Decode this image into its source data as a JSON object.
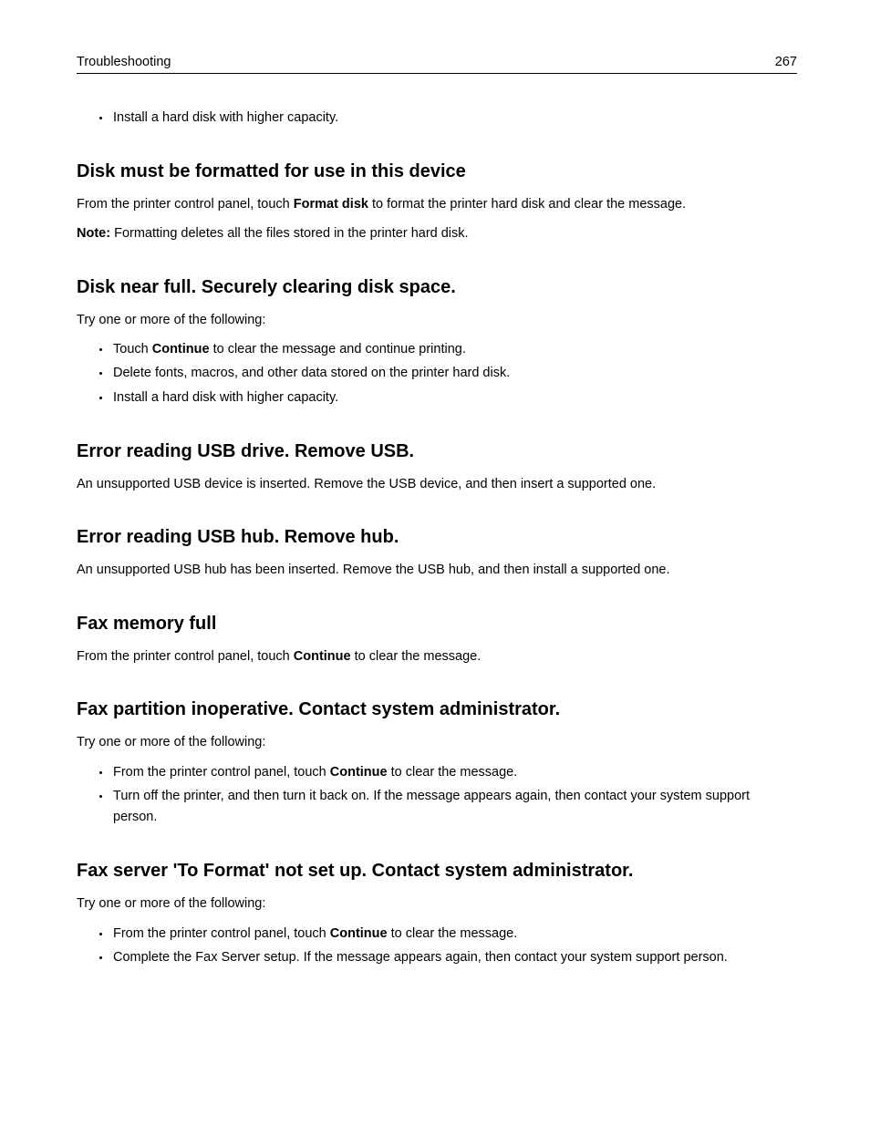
{
  "header": {
    "title": "Troubleshooting",
    "page_number": "267"
  },
  "orphan_bullet": "Install a hard disk with higher capacity.",
  "sections": {
    "disk_format": {
      "heading": "Disk must be formatted for use in this device",
      "p1_a": "From the printer control panel, touch ",
      "p1_bold": "Format disk",
      "p1_b": " to format the printer hard disk and clear the message.",
      "p2_bold": "Note:",
      "p2_b": " Formatting deletes all the files stored in the printer hard disk."
    },
    "disk_near_full": {
      "heading": "Disk near full. Securely clearing disk space.",
      "intro": "Try one or more of the following:",
      "b1_a": "Touch ",
      "b1_bold": "Continue",
      "b1_b": " to clear the message and continue printing.",
      "b2": "Delete fonts, macros, and other data stored on the printer hard disk.",
      "b3": "Install a hard disk with higher capacity."
    },
    "usb_drive": {
      "heading": "Error reading USB drive. Remove USB.",
      "p1": "An unsupported USB device is inserted. Remove the USB device, and then insert a supported one."
    },
    "usb_hub": {
      "heading": "Error reading USB hub. Remove hub.",
      "p1": "An unsupported USB hub has been inserted. Remove the USB hub, and then install a supported one."
    },
    "fax_memory": {
      "heading": "Fax memory full",
      "p1_a": "From the printer control panel, touch ",
      "p1_bold": "Continue",
      "p1_b": " to clear the message."
    },
    "fax_partition": {
      "heading": "Fax partition inoperative. Contact system administrator.",
      "intro": "Try one or more of the following:",
      "b1_a": "From the printer control panel, touch ",
      "b1_bold": "Continue",
      "b1_b": " to clear the message.",
      "b2": "Turn off the printer, and then turn it back on. If the message appears again, then contact your system support person."
    },
    "fax_server": {
      "heading": "Fax server 'To Format' not set up. Contact system administrator.",
      "intro": "Try one or more of the following:",
      "b1_a": "From the printer control panel, touch ",
      "b1_bold": "Continue",
      "b1_b": " to clear the message.",
      "b2": "Complete the Fax Server setup. If the message appears again, then contact your system support person."
    }
  }
}
